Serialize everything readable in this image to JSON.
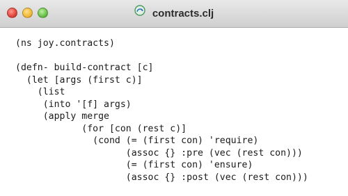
{
  "window": {
    "title": "contracts.clj",
    "file_icon": "clojure-file-icon"
  },
  "editor": {
    "lines": [
      "(ns joy.contracts)",
      "",
      "(defn- build-contract [c]",
      "  (let [args (first c)]",
      "    (list",
      "     (into '[f] args)",
      "     (apply merge",
      "            (for [con (rest c)]",
      "              (cond (= (first con) 'require)",
      "                    (assoc {} :pre (vec (rest con)))",
      "                    (= (first con) 'ensure)",
      "                    (assoc {} :post (vec (rest con)))"
    ]
  }
}
